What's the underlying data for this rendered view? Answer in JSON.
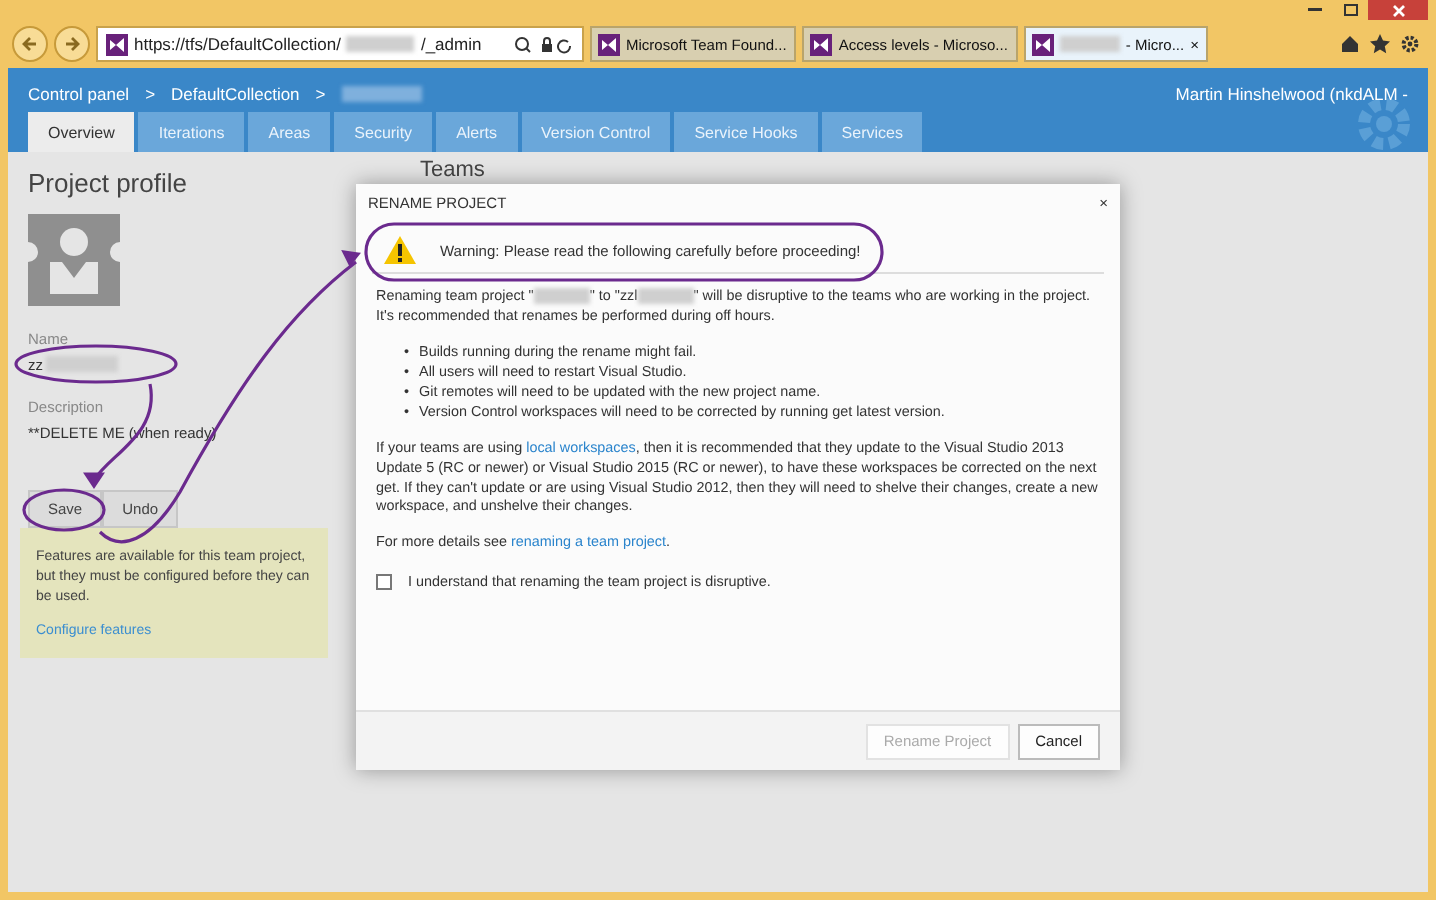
{
  "browser": {
    "url_parts": [
      "https://tfs/DefaultCollection/",
      "/_admin"
    ],
    "tabs": [
      {
        "label": "Microsoft Team Found...",
        "selected": false,
        "redacted": false
      },
      {
        "label": "Access levels - Microso...",
        "selected": false,
        "redacted": false
      },
      {
        "label": " - Micro...",
        "selected": true,
        "redacted": true
      }
    ],
    "close_tab": "×"
  },
  "header": {
    "breadcrumb": [
      "Control panel",
      ">",
      "DefaultCollection",
      ">"
    ],
    "user": "Martin Hinshelwood (nkdALM -"
  },
  "tabs": [
    {
      "label": "Overview",
      "selected": true
    },
    {
      "label": "Iterations",
      "selected": false
    },
    {
      "label": "Areas",
      "selected": false
    },
    {
      "label": "Security",
      "selected": false
    },
    {
      "label": "Alerts",
      "selected": false
    },
    {
      "label": "Version Control",
      "selected": false
    },
    {
      "label": "Service Hooks",
      "selected": false
    },
    {
      "label": "Services",
      "selected": false
    }
  ],
  "profile": {
    "title": "Project profile",
    "name_label": "Name",
    "name_value": "zz",
    "description_label": "Description",
    "description_value": "**DELETE ME (when ready)",
    "buttons": [
      "Save",
      "Undo"
    ],
    "info": "Features are available for this team project, but they must be configured before they can be used.",
    "info_link": "Configure features"
  },
  "teams_title": "Teams",
  "dialog": {
    "title": "RENAME PROJECT",
    "close": "×",
    "warning": "Warning: Please read the following carefully before proceeding!",
    "intro_parts": [
      "Renaming team project \"",
      "\" to \"zzl",
      "\" will be disruptive to the teams who are working in the project. It's recommended that renames be performed during off hours."
    ],
    "bullet": "•",
    "bullets": [
      "Builds running during the rename might fail.",
      "All users will need to restart Visual Studio.",
      "Git remotes will need to be updated with the new project name.",
      "Version Control workspaces will need to be corrected by running get latest version."
    ],
    "para2_before": "If your teams are using ",
    "para2_link": "local workspaces",
    "para2_after": ", then it is recommended that they update to the Visual Studio 2013 Update 5 (RC or newer) or Visual Studio 2015 (RC or newer), to have these workspaces be corrected on the next get. If they can't update or are using Visual Studio 2012, then they will need to shelve their changes, create a new workspace, and unshelve their changes.",
    "details_before": "For more details see ",
    "details_link": "renaming a team project",
    "details_after": ".",
    "confirm": {
      "label": "I understand that renaming the team project is disruptive.",
      "checked": false
    },
    "buttons": [
      {
        "label": "Rename Project",
        "disabled": true
      },
      {
        "label": "Cancel",
        "disabled": false
      }
    ]
  }
}
